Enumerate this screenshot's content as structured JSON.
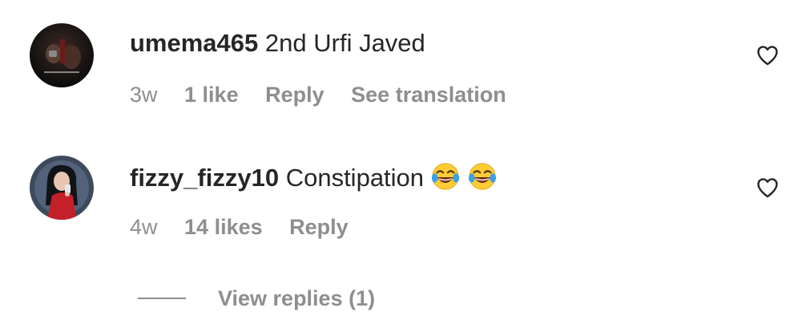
{
  "comments": [
    {
      "username": "umema465",
      "text": "2nd Urfi Javed",
      "emojis": [],
      "time": "3w",
      "likes": "1 like",
      "reply_label": "Reply",
      "translate_label": "See translation",
      "avatar_icon": "dark-photo-avatar",
      "like_icon": "heart-outline-icon"
    },
    {
      "username": "fizzy_fizzy10",
      "text": "Constipation",
      "emojis": [
        "face-with-tears-of-joy-emoji",
        "face-with-tears-of-joy-emoji"
      ],
      "time": "4w",
      "likes": "14 likes",
      "reply_label": "Reply",
      "avatar_icon": "illustrated-girl-avatar",
      "like_icon": "heart-outline-icon"
    }
  ],
  "view_replies": {
    "label": "View replies (1)"
  },
  "colors": {
    "text_primary": "#262626",
    "text_secondary": "#8e8e8e",
    "background": "#ffffff"
  }
}
